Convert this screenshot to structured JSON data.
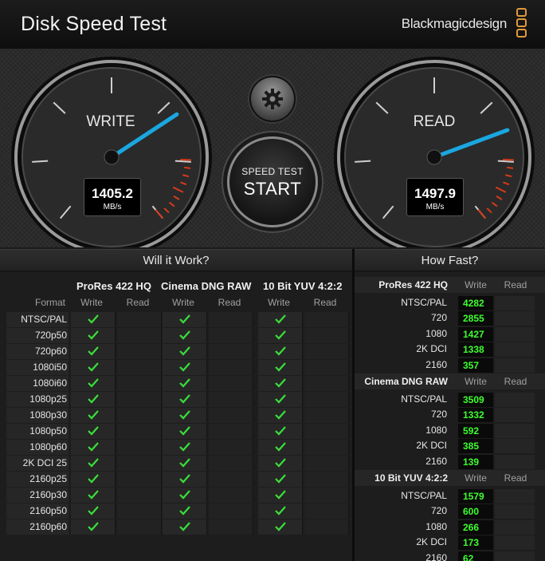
{
  "window": {
    "title": "Disk Speed Test",
    "brand": "Blackmagicdesign"
  },
  "gauges": {
    "write": {
      "label": "WRITE",
      "value": "1405.2",
      "unit": "MB/s",
      "needle_level": 1405.2
    },
    "read": {
      "label": "READ",
      "value": "1497.9",
      "unit": "MB/s",
      "needle_level": 1497.9
    }
  },
  "controls": {
    "settings_icon": "gear-icon",
    "start_small": "SPEED TEST",
    "start_big": "START"
  },
  "will_it_work": {
    "title": "Will it Work?",
    "format_header": "Format",
    "codecs": [
      "ProRes 422 HQ",
      "Cinema DNG RAW",
      "10 Bit YUV 4:2:2"
    ],
    "sub_headers": [
      "Write",
      "Read"
    ],
    "rows": [
      {
        "format": "NTSC/PAL",
        "checks": [
          true,
          false,
          true,
          false,
          true,
          false
        ]
      },
      {
        "format": "720p50",
        "checks": [
          true,
          false,
          true,
          false,
          true,
          false
        ]
      },
      {
        "format": "720p60",
        "checks": [
          true,
          false,
          true,
          false,
          true,
          false
        ]
      },
      {
        "format": "1080i50",
        "checks": [
          true,
          false,
          true,
          false,
          true,
          false
        ]
      },
      {
        "format": "1080i60",
        "checks": [
          true,
          false,
          true,
          false,
          true,
          false
        ]
      },
      {
        "format": "1080p25",
        "checks": [
          true,
          false,
          true,
          false,
          true,
          false
        ]
      },
      {
        "format": "1080p30",
        "checks": [
          true,
          false,
          true,
          false,
          true,
          false
        ]
      },
      {
        "format": "1080p50",
        "checks": [
          true,
          false,
          true,
          false,
          true,
          false
        ]
      },
      {
        "format": "1080p60",
        "checks": [
          true,
          false,
          true,
          false,
          true,
          false
        ]
      },
      {
        "format": "2K DCI 25",
        "checks": [
          true,
          false,
          true,
          false,
          true,
          false
        ]
      },
      {
        "format": "2160p25",
        "checks": [
          true,
          false,
          true,
          false,
          true,
          false
        ]
      },
      {
        "format": "2160p30",
        "checks": [
          true,
          false,
          true,
          false,
          true,
          false
        ]
      },
      {
        "format": "2160p50",
        "checks": [
          true,
          false,
          true,
          false,
          true,
          false
        ]
      },
      {
        "format": "2160p60",
        "checks": [
          true,
          false,
          true,
          false,
          true,
          false
        ]
      }
    ]
  },
  "how_fast": {
    "title": "How Fast?",
    "sub_headers": [
      "Write",
      "Read"
    ],
    "groups": [
      {
        "codec": "ProRes 422 HQ",
        "rows": [
          {
            "label": "NTSC/PAL",
            "write": "4282",
            "read": ""
          },
          {
            "label": "720",
            "write": "2855",
            "read": ""
          },
          {
            "label": "1080",
            "write": "1427",
            "read": ""
          },
          {
            "label": "2K DCI",
            "write": "1338",
            "read": ""
          },
          {
            "label": "2160",
            "write": "357",
            "read": ""
          }
        ]
      },
      {
        "codec": "Cinema DNG RAW",
        "rows": [
          {
            "label": "NTSC/PAL",
            "write": "3509",
            "read": ""
          },
          {
            "label": "720",
            "write": "1332",
            "read": ""
          },
          {
            "label": "1080",
            "write": "592",
            "read": ""
          },
          {
            "label": "2K DCI",
            "write": "385",
            "read": ""
          },
          {
            "label": "2160",
            "write": "139",
            "read": ""
          }
        ]
      },
      {
        "codec": "10 Bit YUV 4:2:2",
        "rows": [
          {
            "label": "NTSC/PAL",
            "write": "1579",
            "read": ""
          },
          {
            "label": "720",
            "write": "600",
            "read": ""
          },
          {
            "label": "1080",
            "write": "266",
            "read": ""
          },
          {
            "label": "2K DCI",
            "write": "173",
            "read": ""
          },
          {
            "label": "2160",
            "write": "62",
            "read": ""
          }
        ]
      }
    ]
  },
  "colors": {
    "accent_needle": "#1aa7e0",
    "value_green": "#3dff2e",
    "check_green": "#3adf3a",
    "redline": "#d63a1a",
    "logo": "#e09a3a"
  }
}
